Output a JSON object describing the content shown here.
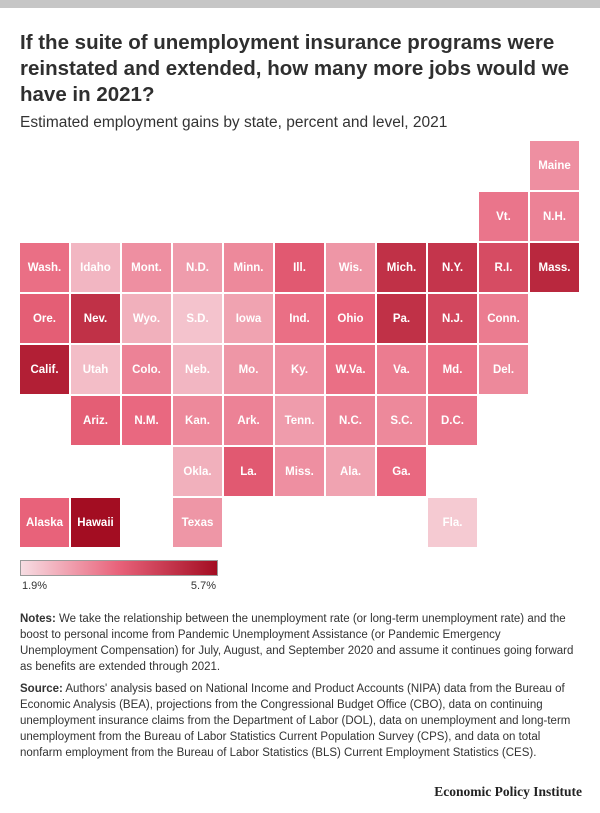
{
  "header": {
    "title": "If the suite of unemployment insurance programs were reinstated and extended, how many more jobs would we have in 2021?",
    "subtitle": "Estimated employment gains by state, percent and level, 2021"
  },
  "legend": {
    "min_label": "1.9%",
    "max_label": "5.7%"
  },
  "notes": {
    "label": "Notes:",
    "text": "We take the relationship between the unemployment rate (or long-term unemployment rate) and the boost to personal income from Pandemic Unemployment Assistance (or Pandemic Emergency Unemployment Compensation) for July, August, and September 2020 and assume it continues going forward as benefits are extended through 2021."
  },
  "source": {
    "label": "Source:",
    "text": "Authors' analysis based on National Income and Product Accounts (NIPA) data from the Bureau of Economic Analysis (BEA), projections from the Congressional Budget Office (CBO), data on continuing unemployment insurance claims from the Department of Labor (DOL), data on unemployment and long-term unemployment from the Bureau of Labor Statistics Current Population Survey (CPS), and data on total nonfarm employment from the Bureau of Labor Statistics (BLS) Current Employment Statistics (CES)."
  },
  "brand": "Economic Policy Institute",
  "chart_data": {
    "type": "heatmap",
    "subtype": "tile-grid map",
    "title": "If the suite of unemployment insurance programs were reinstated and extended, how many more jobs would we have in 2021?",
    "subtitle": "Estimated employment gains by state, percent and level, 2021",
    "color_scale": {
      "min": 1.9,
      "max": 5.7,
      "low_color": "#f7dde3",
      "mid_color": "#e8627a",
      "high_color": "#a30d22"
    },
    "tiles": [
      {
        "label": "Maine",
        "col": 10,
        "row": 0,
        "value": 3.1
      },
      {
        "label": "Vt.",
        "col": 9,
        "row": 1,
        "value": 3.5
      },
      {
        "label": "N.H.",
        "col": 10,
        "row": 1,
        "value": 3.3
      },
      {
        "label": "Wash.",
        "col": 0,
        "row": 2,
        "value": 3.6
      },
      {
        "label": "Idaho",
        "col": 1,
        "row": 2,
        "value": 2.5
      },
      {
        "label": "Mont.",
        "col": 2,
        "row": 2,
        "value": 3.1
      },
      {
        "label": "N.D.",
        "col": 3,
        "row": 2,
        "value": 2.9
      },
      {
        "label": "Minn.",
        "col": 4,
        "row": 2,
        "value": 3.2
      },
      {
        "label": "Ill.",
        "col": 5,
        "row": 2,
        "value": 4.0
      },
      {
        "label": "Wis.",
        "col": 6,
        "row": 2,
        "value": 3.0
      },
      {
        "label": "Mich.",
        "col": 7,
        "row": 2,
        "value": 4.9
      },
      {
        "label": "N.Y.",
        "col": 8,
        "row": 2,
        "value": 4.8
      },
      {
        "label": "R.I.",
        "col": 9,
        "row": 2,
        "value": 4.3
      },
      {
        "label": "Mass.",
        "col": 10,
        "row": 2,
        "value": 5.1
      },
      {
        "label": "Ore.",
        "col": 0,
        "row": 3,
        "value": 3.9
      },
      {
        "label": "Nev.",
        "col": 1,
        "row": 3,
        "value": 4.9
      },
      {
        "label": "Wyo.",
        "col": 2,
        "row": 3,
        "value": 2.6
      },
      {
        "label": "S.D.",
        "col": 3,
        "row": 3,
        "value": 2.3
      },
      {
        "label": "Iowa",
        "col": 4,
        "row": 3,
        "value": 2.8
      },
      {
        "label": "Ind.",
        "col": 5,
        "row": 3,
        "value": 3.6
      },
      {
        "label": "Ohio",
        "col": 6,
        "row": 3,
        "value": 3.8
      },
      {
        "label": "Pa.",
        "col": 7,
        "row": 3,
        "value": 4.9
      },
      {
        "label": "N.J.",
        "col": 8,
        "row": 3,
        "value": 4.4
      },
      {
        "label": "Conn.",
        "col": 9,
        "row": 3,
        "value": 3.4
      },
      {
        "label": "Calif.",
        "col": 0,
        "row": 4,
        "value": 5.3
      },
      {
        "label": "Utah",
        "col": 1,
        "row": 4,
        "value": 2.4
      },
      {
        "label": "Colo.",
        "col": 2,
        "row": 4,
        "value": 3.3
      },
      {
        "label": "Neb.",
        "col": 3,
        "row": 4,
        "value": 2.5
      },
      {
        "label": "Mo.",
        "col": 4,
        "row": 4,
        "value": 3.0
      },
      {
        "label": "Ky.",
        "col": 5,
        "row": 4,
        "value": 3.1
      },
      {
        "label": "W.Va.",
        "col": 6,
        "row": 4,
        "value": 3.6
      },
      {
        "label": "Va.",
        "col": 7,
        "row": 4,
        "value": 3.4
      },
      {
        "label": "Md.",
        "col": 8,
        "row": 4,
        "value": 3.6
      },
      {
        "label": "Del.",
        "col": 9,
        "row": 4,
        "value": 3.2
      },
      {
        "label": "Ariz.",
        "col": 1,
        "row": 5,
        "value": 3.9
      },
      {
        "label": "N.M.",
        "col": 2,
        "row": 5,
        "value": 3.7
      },
      {
        "label": "Kan.",
        "col": 3,
        "row": 5,
        "value": 3.2
      },
      {
        "label": "Ark.",
        "col": 4,
        "row": 5,
        "value": 3.3
      },
      {
        "label": "Tenn.",
        "col": 5,
        "row": 5,
        "value": 2.9
      },
      {
        "label": "N.C.",
        "col": 6,
        "row": 5,
        "value": 3.3
      },
      {
        "label": "S.C.",
        "col": 7,
        "row": 5,
        "value": 3.2
      },
      {
        "label": "D.C.",
        "col": 8,
        "row": 5,
        "value": 3.5
      },
      {
        "label": "Okla.",
        "col": 3,
        "row": 6,
        "value": 2.6
      },
      {
        "label": "La.",
        "col": 4,
        "row": 6,
        "value": 4.0
      },
      {
        "label": "Miss.",
        "col": 5,
        "row": 6,
        "value": 3.1
      },
      {
        "label": "Ala.",
        "col": 6,
        "row": 6,
        "value": 2.8
      },
      {
        "label": "Ga.",
        "col": 7,
        "row": 6,
        "value": 3.7
      },
      {
        "label": "Alaska",
        "col": 0,
        "row": 7,
        "value": 3.8
      },
      {
        "label": "Hawaii",
        "col": 1,
        "row": 7,
        "value": 5.7
      },
      {
        "label": "Texas",
        "col": 3,
        "row": 7,
        "value": 3.0
      },
      {
        "label": "Fla.",
        "col": 8,
        "row": 7,
        "value": 2.2
      }
    ]
  }
}
